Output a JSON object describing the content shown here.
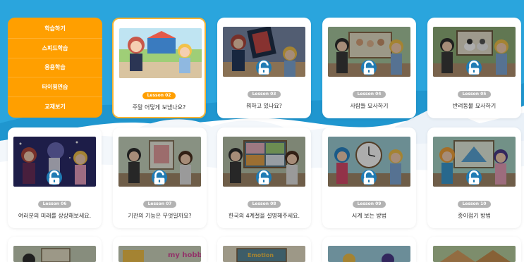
{
  "menu": {
    "items": [
      "학습하기",
      "스피드학습",
      "응용학습",
      "타이핑연습",
      "교재보기"
    ]
  },
  "colors": {
    "accent": "#ff9f00",
    "sky": "#1f96cf",
    "lock": "#1f7bb4",
    "badge_inactive": "#b3b3b3"
  },
  "lessons": [
    {
      "number": "Lesson 02",
      "title": "주말 어떻게 보냈나요?",
      "locked": false,
      "active": true
    },
    {
      "number": "Lesson 03",
      "title": "뭐하고 있나요?",
      "locked": true,
      "active": false
    },
    {
      "number": "Lesson 04",
      "title": "사람들 묘사하기",
      "locked": true,
      "active": false
    },
    {
      "number": "Lesson 05",
      "title": "반려동물 묘사하기",
      "locked": true,
      "active": false
    },
    {
      "number": "Lesson 06",
      "title": "여러분의 미래를 상상해보세요.",
      "locked": true,
      "active": false
    },
    {
      "number": "Lesson 07",
      "title": "기관의 기능은 무엇일까요?",
      "locked": true,
      "active": false
    },
    {
      "number": "Lesson 08",
      "title": "한국의 4계절을 설명해주세요.",
      "locked": true,
      "active": false
    },
    {
      "number": "Lesson 09",
      "title": "시계 보는 방법",
      "locked": true,
      "active": false
    },
    {
      "number": "Lesson 10",
      "title": "종이접기 방법",
      "locked": true,
      "active": false
    }
  ],
  "partial_card_text": {
    "my_hobby": "my hobby",
    "emotion": "Emotion"
  }
}
